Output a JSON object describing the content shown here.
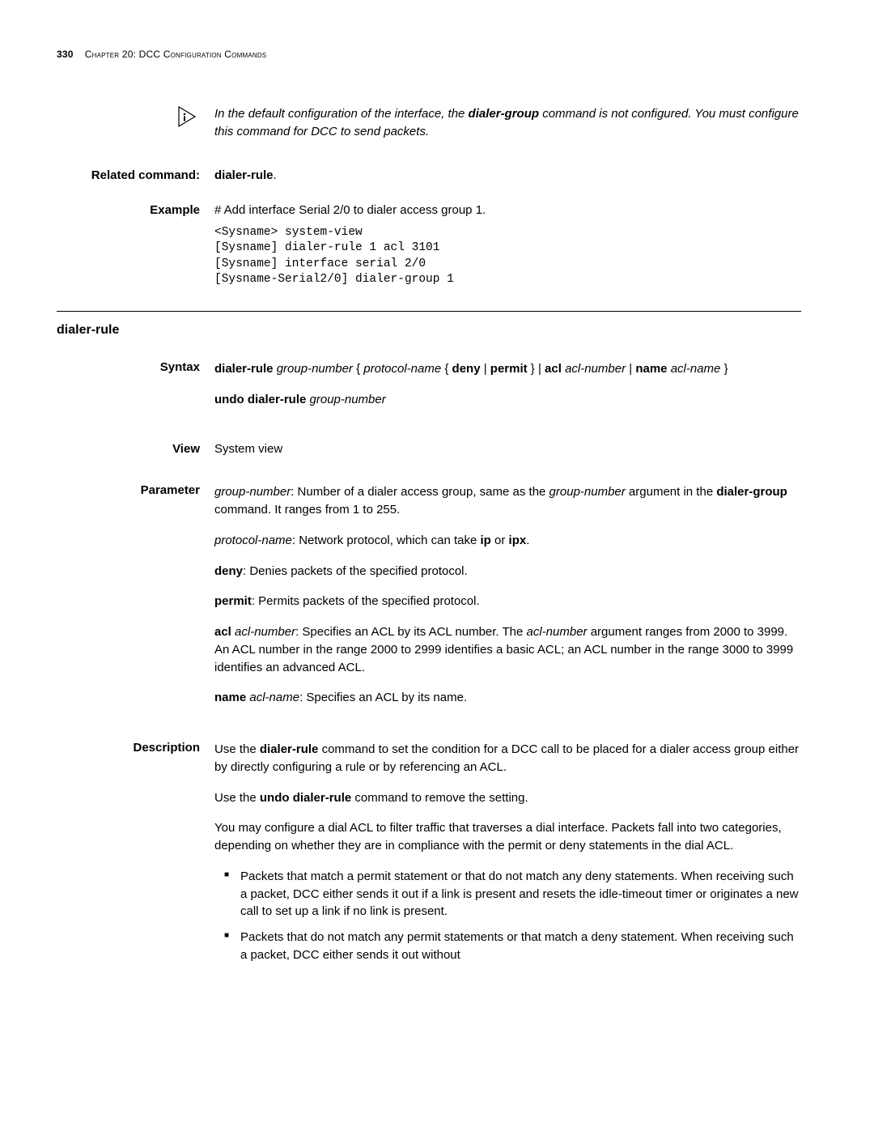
{
  "header": {
    "page_number": "330",
    "chapter": "Chapter 20: DCC Configuration Commands"
  },
  "note": {
    "before": "In the default configuration of the interface, the ",
    "bold": "dialer-group",
    "after": " command is not configured. You must configure this command for DCC to send packets."
  },
  "related": {
    "label": "Related command:",
    "value": "dialer-rule",
    "suffix": "."
  },
  "example": {
    "label": "Example",
    "desc": "# Add interface Serial 2/0 to dialer access group 1.",
    "cli": "<Sysname> system-view\n[Sysname] dialer-rule 1 acl 3101\n[Sysname] interface serial 2/0\n[Sysname-Serial2/0] dialer-group 1"
  },
  "section": {
    "title": "dialer-rule",
    "syntax": {
      "label": "Syntax",
      "line_parts": {
        "cmd": "dialer-rule",
        "gn": "group-number",
        "ob": " { ",
        "pn": "protocol-name",
        "ob2": " { ",
        "deny": "deny",
        "pipe": " | ",
        "permit": "permit",
        "cb": " } | ",
        "acl": "acl",
        "sp": " ",
        "an": "acl-number",
        "pipe2": " | ",
        "name": "name",
        "sp2": " ",
        "aname": "acl-name",
        "end": " }"
      },
      "undo_parts": {
        "cmd": "undo dialer-rule",
        "gn": "group-number"
      }
    },
    "view": {
      "label": "View",
      "value": "System view"
    },
    "parameter": {
      "label": "Parameter",
      "p1_a": "group-number",
      "p1_b": ": Number of a dialer access group, same as the ",
      "p1_c": "group-number",
      "p1_d": " argument in the ",
      "p1_e": "dialer-group",
      "p1_f": " command. It ranges from 1 to 255.",
      "p2_a": "protocol-name",
      "p2_b": ": Network protocol, which can take ",
      "p2_c": "ip",
      "p2_d": " or ",
      "p2_e": "ipx",
      "p2_f": ".",
      "p3_a": "deny",
      "p3_b": ": Denies packets of the specified protocol.",
      "p4_a": "permit",
      "p4_b": ": Permits packets of the specified protocol.",
      "p5_a": "acl",
      "p5_b": " ",
      "p5_c": "acl-number",
      "p5_d": ": Specifies an ACL by its ACL number. The ",
      "p5_e": "acl-number",
      "p5_f": " argument ranges from 2000 to 3999. An ACL number in the range 2000 to 2999 identifies a basic ACL; an ACL number in the range 3000 to 3999 identifies an advanced ACL.",
      "p6_a": "name",
      "p6_b": " ",
      "p6_c": "acl-name",
      "p6_d": ": Specifies an ACL by its name."
    },
    "description": {
      "label": "Description",
      "d1_a": "Use the ",
      "d1_b": "dialer-rule",
      "d1_c": " command to set the condition for a DCC call to be placed for a dialer access group either by directly configuring a rule or by referencing an ACL.",
      "d2_a": "Use the ",
      "d2_b": "undo dialer-rule",
      "d2_c": " command to remove the setting.",
      "d3": "You may configure a dial ACL to filter traffic that traverses a dial interface. Packets fall into two categories, depending on whether they are in compliance with the permit or deny statements in the dial ACL.",
      "li1": "Packets that match a permit statement or that do not match any deny statements. When receiving such a packet, DCC either sends it out if a link is present and resets the idle-timeout timer or originates a new call to set up a link if no link is present.",
      "li2": "Packets that do not match any permit statements or that match a deny statement. When receiving such a packet, DCC either sends it out without"
    }
  }
}
